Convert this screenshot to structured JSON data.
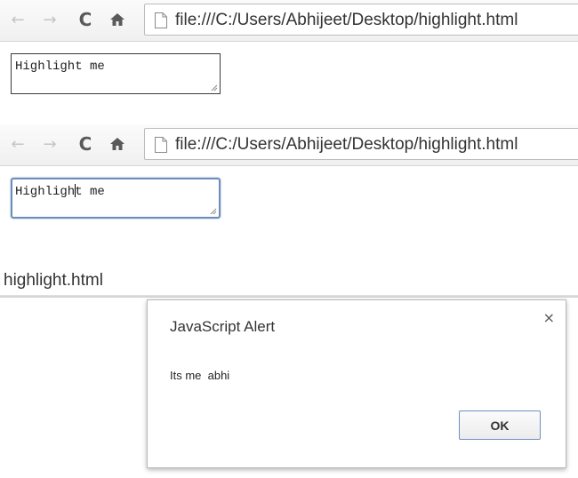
{
  "browser": {
    "url": "file:///C:/Users/Abhijeet/Desktop/highlight.html",
    "icons": {
      "back": "arrow-left-icon",
      "forward": "arrow-right-icon",
      "reload": "reload-icon",
      "home": "home-icon",
      "page": "page-icon"
    }
  },
  "section1": {
    "textarea_value": "Highlight me"
  },
  "section2": {
    "textarea_before_caret": "Highligh",
    "textarea_after_caret": "t me"
  },
  "section3": {
    "tab_title": "highlight.html",
    "alert": {
      "title": "JavaScript Alert",
      "close_glyph": "×",
      "message": "Its me  abhi",
      "ok_label": "OK"
    }
  },
  "colors": {
    "focus_border": "#6b8cba",
    "ok_border": "#6f8fc4"
  }
}
